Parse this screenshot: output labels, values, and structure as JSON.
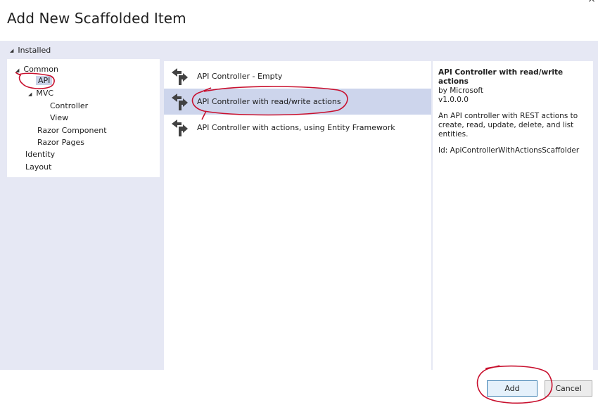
{
  "dialog": {
    "title": "Add New Scaffolded Item",
    "close_glyph": "×"
  },
  "tree": {
    "installed_label": "Installed",
    "items": {
      "common": "Common",
      "api": "API",
      "mvc": "MVC",
      "controller": "Controller",
      "view": "View",
      "razor_component": "Razor Component",
      "razor_pages": "Razor Pages",
      "identity": "Identity",
      "layout": "Layout"
    },
    "selected": "API"
  },
  "list": {
    "items": [
      {
        "label": "API Controller - Empty",
        "icon": "scaffold-controller-icon"
      },
      {
        "label": "API Controller with read/write actions",
        "icon": "scaffold-controller-icon",
        "selected": true
      },
      {
        "label": "API Controller with actions, using Entity Framework",
        "icon": "scaffold-controller-icon"
      }
    ]
  },
  "details": {
    "title": "API Controller with read/write actions",
    "author": "by Microsoft",
    "version": "v1.0.0.0",
    "description": "An API controller with REST actions to create, read, update, delete, and list entities.",
    "id_text": "Id: ApiControllerWithActionsScaffolder"
  },
  "buttons": {
    "add": "Add",
    "cancel": "Cancel"
  },
  "colors": {
    "background_panel": "#e6e8f4",
    "selection": "#cdd5ec",
    "annotation_red": "#c8102e"
  }
}
